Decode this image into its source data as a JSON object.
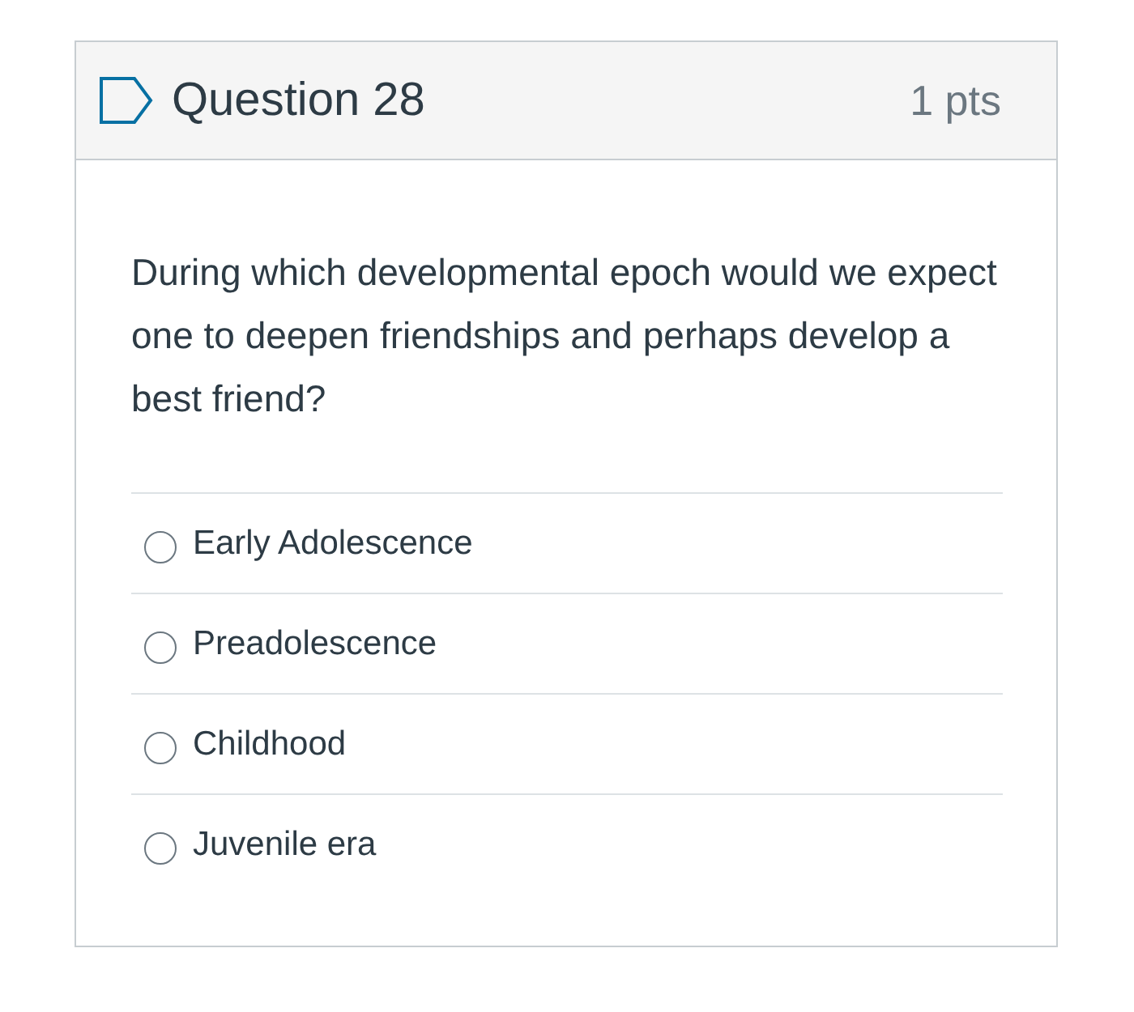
{
  "question": {
    "title": "Question 28",
    "points": "1 pts",
    "flagged": false,
    "text": "During which developmental epoch would we expect one to deepen friendships and perhaps develop a best friend?",
    "answers": [
      {
        "label": "Early Adolescence",
        "selected": false
      },
      {
        "label": "Preadolescence",
        "selected": false
      },
      {
        "label": "Childhood",
        "selected": false
      },
      {
        "label": "Juvenile era",
        "selected": false
      }
    ]
  }
}
